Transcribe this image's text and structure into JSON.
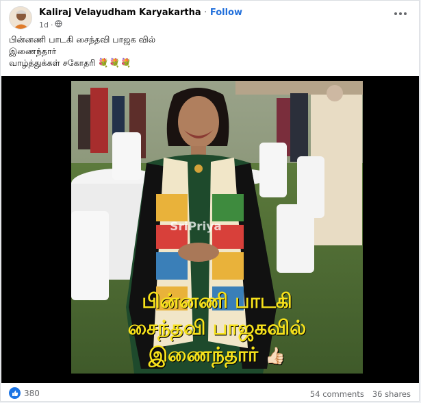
{
  "post": {
    "author": "Kaliraj Velayudham Karyakartha",
    "separator": "·",
    "follow_label": "Follow",
    "time": "1d",
    "privacy_icon": "globe-icon",
    "more_icon": "more-options-icon",
    "text_lines": [
      "பின்னணி பாடகி சைந்தவி பாஜக வில்",
      "இணைந்தார்",
      "வாழ்த்துக்கள் சகோதரி"
    ],
    "emoji": "💐💐💐"
  },
  "media": {
    "watermark": "SriPriya",
    "overlay_lines": [
      "பின்னணி பாடகி",
      "சைந்தவி பாஜகவில்",
      "இணைந்தார்"
    ],
    "overlay_emoji": "👍🏻",
    "overlay_color": "#f7e21b"
  },
  "footer": {
    "reaction_icon": "like-icon",
    "reaction_count": "380",
    "comments": "54 comments",
    "shares": "36 shares"
  }
}
